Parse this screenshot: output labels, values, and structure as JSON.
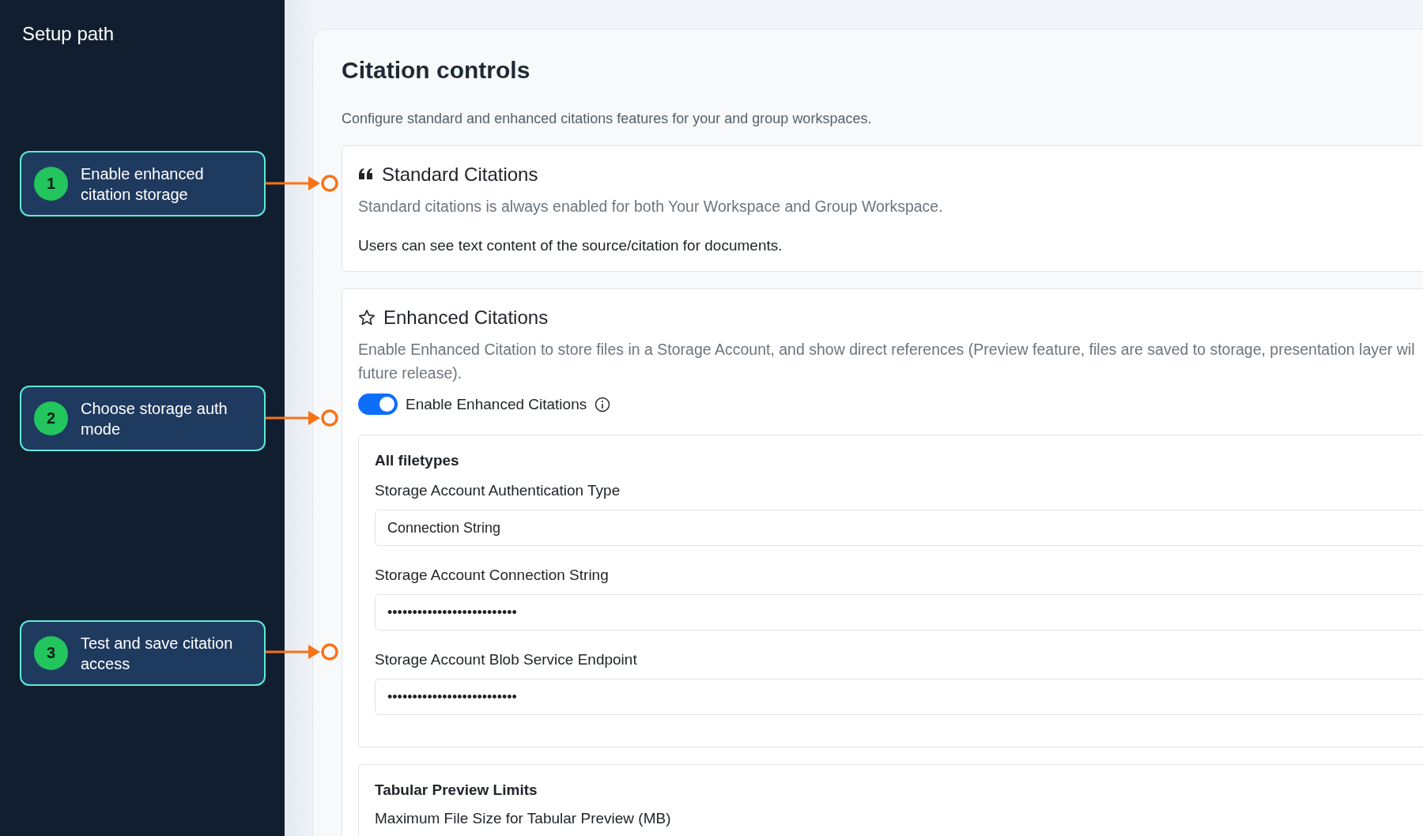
{
  "sidebar": {
    "title": "Setup path",
    "steps": [
      {
        "number": "1",
        "text": "Enable enhanced citation storage"
      },
      {
        "number": "2",
        "text": "Choose storage auth mode"
      },
      {
        "number": "3",
        "text": "Test and save citation access"
      }
    ]
  },
  "page": {
    "title": "Citation controls",
    "subtitle": "Configure standard and enhanced citations features for your and group workspaces."
  },
  "standard": {
    "title": "Standard Citations",
    "description": "Standard citations is always enabled for both Your Workspace and Group Workspace.",
    "note": "Users can see text content of the source/citation for documents."
  },
  "enhanced": {
    "title": "Enhanced Citations",
    "description_lines": [
      "Enable Enhanced Citation to store files in a Storage Account, and show direct references (Preview feature, files are saved to storage, presentation layer wil",
      "future release)."
    ],
    "toggle": {
      "label": "Enable Enhanced Citations",
      "on": true
    },
    "filetypes": {
      "title": "All filetypes",
      "fields": [
        {
          "label": "Storage Account Authentication Type",
          "value": "Connection String"
        },
        {
          "label": "Storage Account Connection String",
          "value": "••••••••••••••••••••••••••"
        },
        {
          "label": "Storage Account Blob Service Endpoint",
          "value": "••••••••••••••••••••••••••"
        }
      ]
    },
    "tabular": {
      "title": "Tabular Preview Limits",
      "label": "Maximum File Size for Tabular Preview (MB)"
    }
  }
}
